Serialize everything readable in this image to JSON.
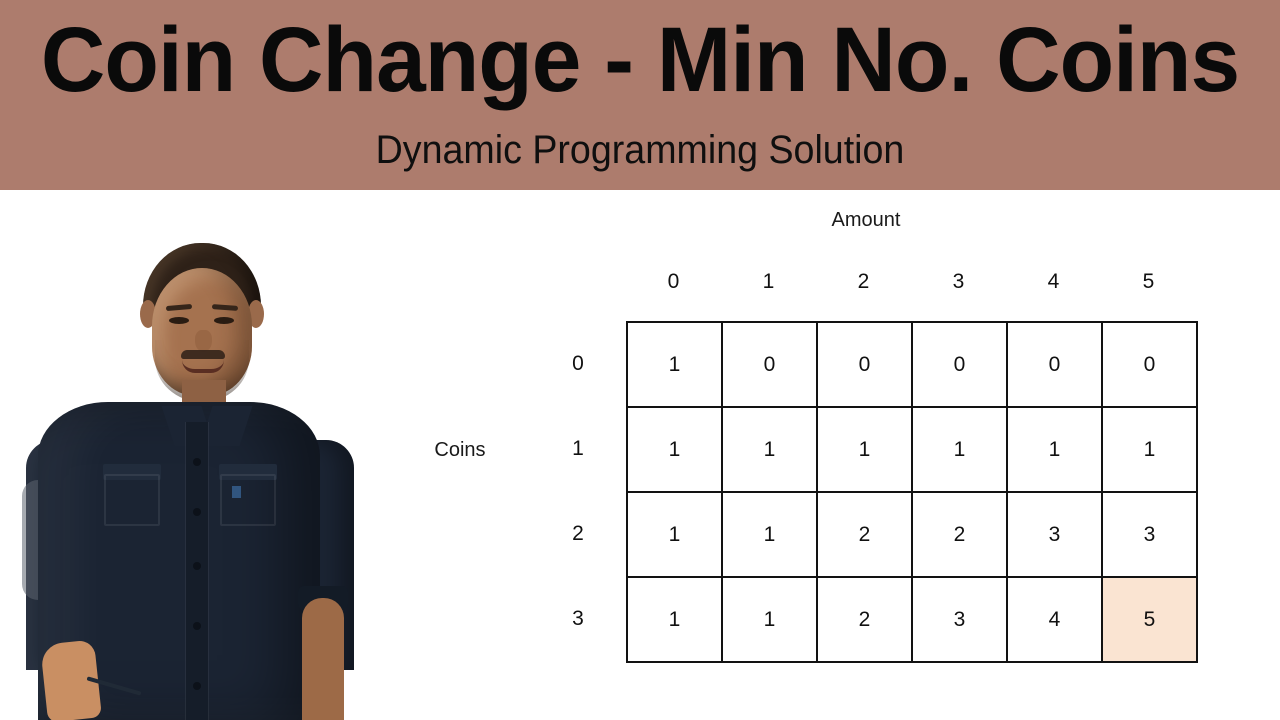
{
  "header": {
    "title": "Coin Change - Min No. Coins",
    "subtitle": "Dynamic Programming Solution",
    "band_color": "#ad7c6d",
    "title_color": "#0a0a0a"
  },
  "presenter": {
    "alt": "presenter-photo",
    "shirt_color": "#1b2433",
    "skin_color": "#a5724f",
    "background": "#ffffff"
  },
  "matrix": {
    "top_axis_label": "Amount",
    "left_axis_label": "Coins",
    "column_headers": [
      "0",
      "1",
      "2",
      "3",
      "4",
      "5"
    ],
    "row_headers": [
      "0",
      "1",
      "2",
      "3"
    ],
    "rows": [
      [
        "1",
        "0",
        "0",
        "0",
        "0",
        "0"
      ],
      [
        "1",
        "1",
        "1",
        "1",
        "1",
        "1"
      ],
      [
        "1",
        "1",
        "2",
        "2",
        "3",
        "3"
      ],
      [
        "1",
        "1",
        "2",
        "3",
        "4",
        "5"
      ]
    ],
    "highlight": {
      "row": 3,
      "col": 5,
      "color": "#fae4d2"
    },
    "grid_color": "#121212",
    "cell_background": "#ffffff"
  },
  "chart_data": {
    "type": "table",
    "title": "Coin Change - Min No. Coins",
    "xlabel": "Amount",
    "ylabel": "Coins",
    "categories": [
      "0",
      "1",
      "2",
      "3",
      "4",
      "5"
    ],
    "row_labels": [
      "0",
      "1",
      "2",
      "3"
    ],
    "series": [
      {
        "name": "0",
        "values": [
          1,
          0,
          0,
          0,
          0,
          0
        ]
      },
      {
        "name": "1",
        "values": [
          1,
          1,
          1,
          1,
          1,
          1
        ]
      },
      {
        "name": "2",
        "values": [
          1,
          1,
          2,
          2,
          3,
          3
        ]
      },
      {
        "name": "3",
        "values": [
          1,
          1,
          2,
          3,
          4,
          5
        ]
      }
    ],
    "highlighted_cell": {
      "row_label": "3",
      "column_label": "5",
      "value": 5
    },
    "grid": true,
    "legend": "none"
  }
}
